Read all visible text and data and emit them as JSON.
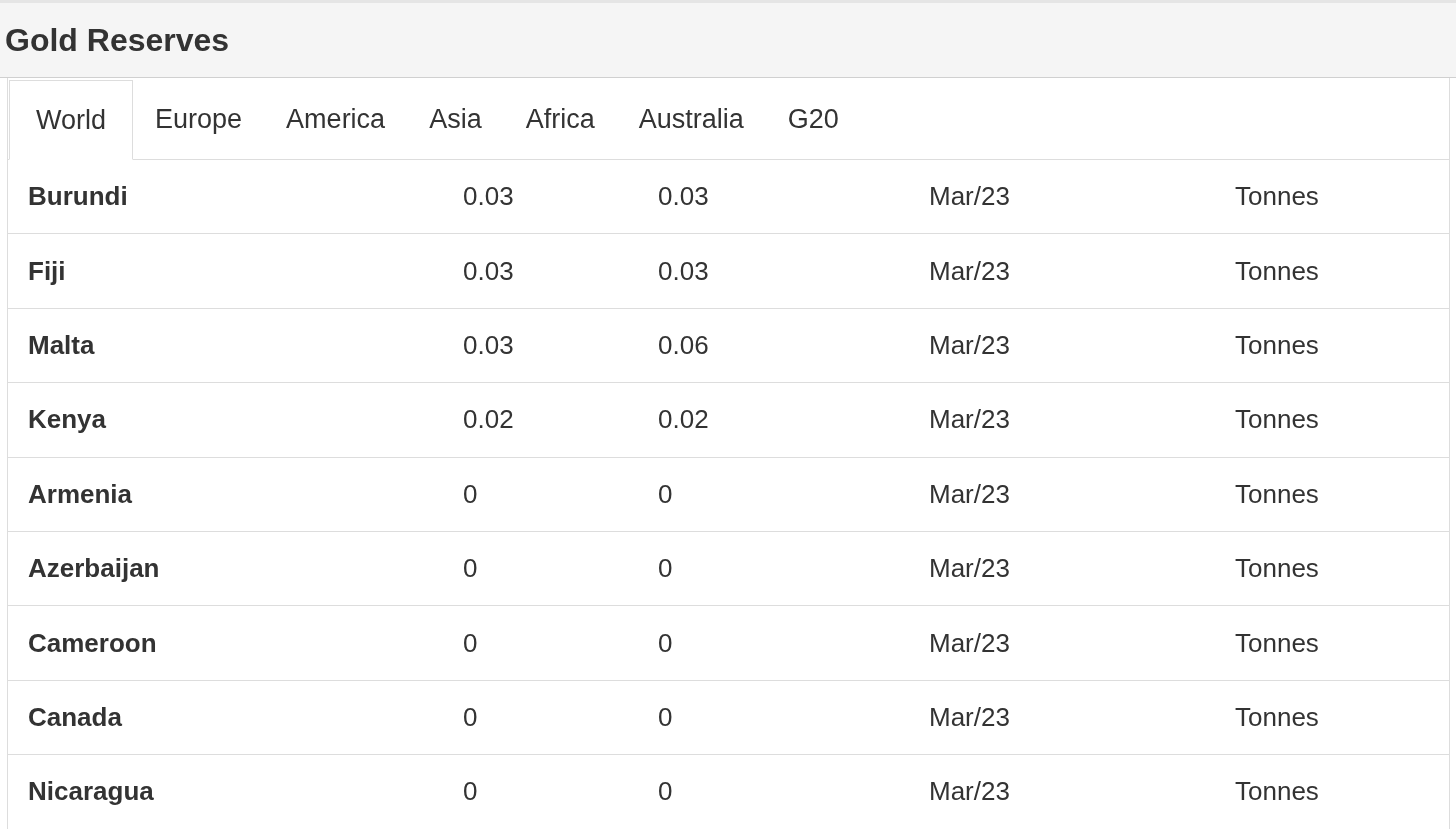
{
  "title": "Gold Reserves",
  "tabs": [
    {
      "label": "World",
      "selected": true
    },
    {
      "label": "Europe",
      "selected": false
    },
    {
      "label": "America",
      "selected": false
    },
    {
      "label": "Asia",
      "selected": false
    },
    {
      "label": "Africa",
      "selected": false
    },
    {
      "label": "Australia",
      "selected": false
    },
    {
      "label": "G20",
      "selected": false
    }
  ],
  "rows": [
    {
      "country": "Burundi",
      "column_2": "0.03",
      "column_3": "0.03",
      "date": "Mar/23",
      "unit": "Tonnes"
    },
    {
      "country": "Fiji",
      "column_2": "0.03",
      "column_3": "0.03",
      "date": "Mar/23",
      "unit": "Tonnes"
    },
    {
      "country": "Malta",
      "column_2": "0.03",
      "column_3": "0.06",
      "date": "Mar/23",
      "unit": "Tonnes"
    },
    {
      "country": "Kenya",
      "column_2": "0.02",
      "column_3": "0.02",
      "date": "Mar/23",
      "unit": "Tonnes"
    },
    {
      "country": "Armenia",
      "column_2": "0",
      "column_3": "0",
      "date": "Mar/23",
      "unit": "Tonnes"
    },
    {
      "country": "Azerbaijan",
      "column_2": "0",
      "column_3": "0",
      "date": "Mar/23",
      "unit": "Tonnes"
    },
    {
      "country": "Cameroon",
      "column_2": "0",
      "column_3": "0",
      "date": "Mar/23",
      "unit": "Tonnes"
    },
    {
      "country": "Canada",
      "column_2": "0",
      "column_3": "0",
      "date": "Mar/23",
      "unit": "Tonnes"
    },
    {
      "country": "Nicaragua",
      "column_2": "0",
      "column_3": "0",
      "date": "Mar/23",
      "unit": "Tonnes"
    }
  ]
}
